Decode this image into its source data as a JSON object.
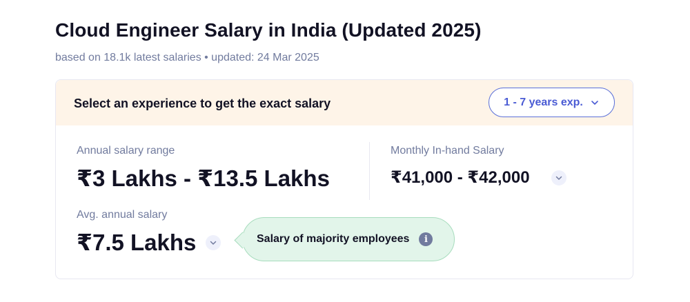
{
  "page": {
    "title": "Cloud Engineer Salary in India (Updated 2025)",
    "subtitle": "based on 18.1k latest salaries • updated: 24 Mar 2025"
  },
  "experience": {
    "prompt": "Select an experience to get the exact salary",
    "selected": "1 - 7 years exp."
  },
  "annual_range": {
    "label": "Annual salary range",
    "value": "₹3 Lakhs - ₹13.5 Lakhs"
  },
  "monthly_inhand": {
    "label": "Monthly In-hand Salary",
    "value": "₹41,000 - ₹42,000"
  },
  "avg_annual": {
    "label": "Avg. annual salary",
    "value": "₹7.5 Lakhs"
  },
  "tooltip": {
    "text": "Salary of majority employees",
    "icon_glyph": "i"
  },
  "icons": {
    "chevron": "chevron-down-icon",
    "info": "info-icon"
  },
  "colors": {
    "accent": "#4a5bd4",
    "header_bg": "#fef4e8",
    "tooltip_bg": "#e2f5ea"
  }
}
